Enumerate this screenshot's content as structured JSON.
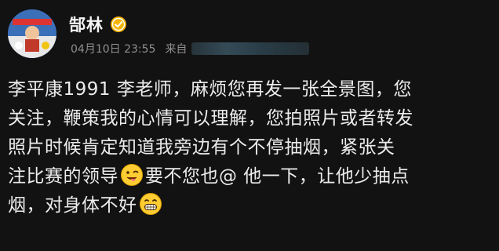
{
  "post": {
    "author": {
      "name": "郜林",
      "avatar_icon": "avatar-image",
      "verified_icon": "verified-badge-icon",
      "verified_color": "#f5b400"
    },
    "meta": {
      "time": "04月10日 23:55",
      "source_label": "来自"
    },
    "content": {
      "line1": "李平康1991 李老师，麻烦您再发一张全景图，您",
      "line2": "关注，鞭策我的心情可以理解，您拍照片或者转发",
      "line3": "照片时候肯定知道我旁边有个不停抽烟，紧张关",
      "line4_before_emoji": "注比赛的领导",
      "line4_emoji": "winking-tongue-emoji",
      "line4_after_emoji": "要不您也@ 他一下，让他少抽点",
      "line5_before_emoji": "烟，对身体不好",
      "line5_emoji": "grinning-emoji"
    }
  },
  "colors": {
    "background": "#121212",
    "text": "#ececec",
    "meta_text": "#8f8f8f"
  }
}
